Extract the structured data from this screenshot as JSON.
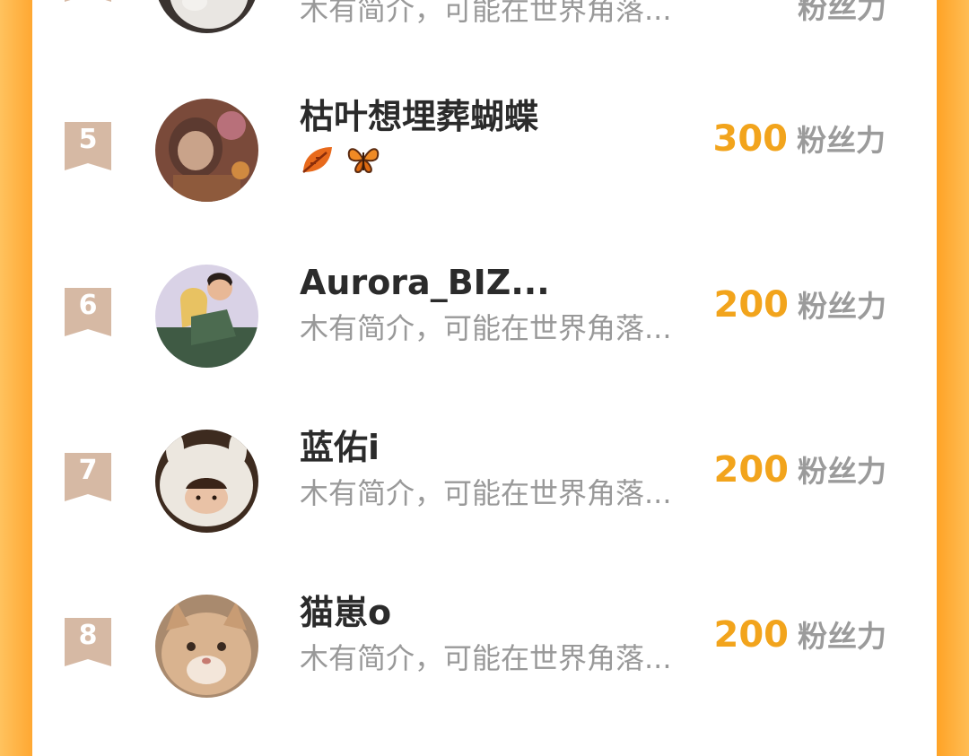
{
  "colors": {
    "accent": "#f2a41c",
    "edge": "#ffa832",
    "badge": "#d6b9a4"
  },
  "rows": [
    {
      "rank": "",
      "name": "",
      "bio": "木有简介，可能在世界角落...",
      "score": "",
      "unit": "粉丝力"
    },
    {
      "rank": "5",
      "name": "枯叶想埋葬蝴蝶",
      "emoji": [
        "fallen-leaf-emoji",
        "butterfly-emoji"
      ],
      "score": "300",
      "unit": "粉丝力"
    },
    {
      "rank": "6",
      "name": "Aurora_BIZ...",
      "bio": "木有简介，可能在世界角落...",
      "score": "200",
      "unit": "粉丝力"
    },
    {
      "rank": "7",
      "name": "蓝佑i",
      "bio": "木有简介，可能在世界角落...",
      "score": "200",
      "unit": "粉丝力"
    },
    {
      "rank": "8",
      "name": "猫崽o",
      "bio": "木有简介，可能在世界角落...",
      "score": "200",
      "unit": "粉丝力"
    }
  ]
}
